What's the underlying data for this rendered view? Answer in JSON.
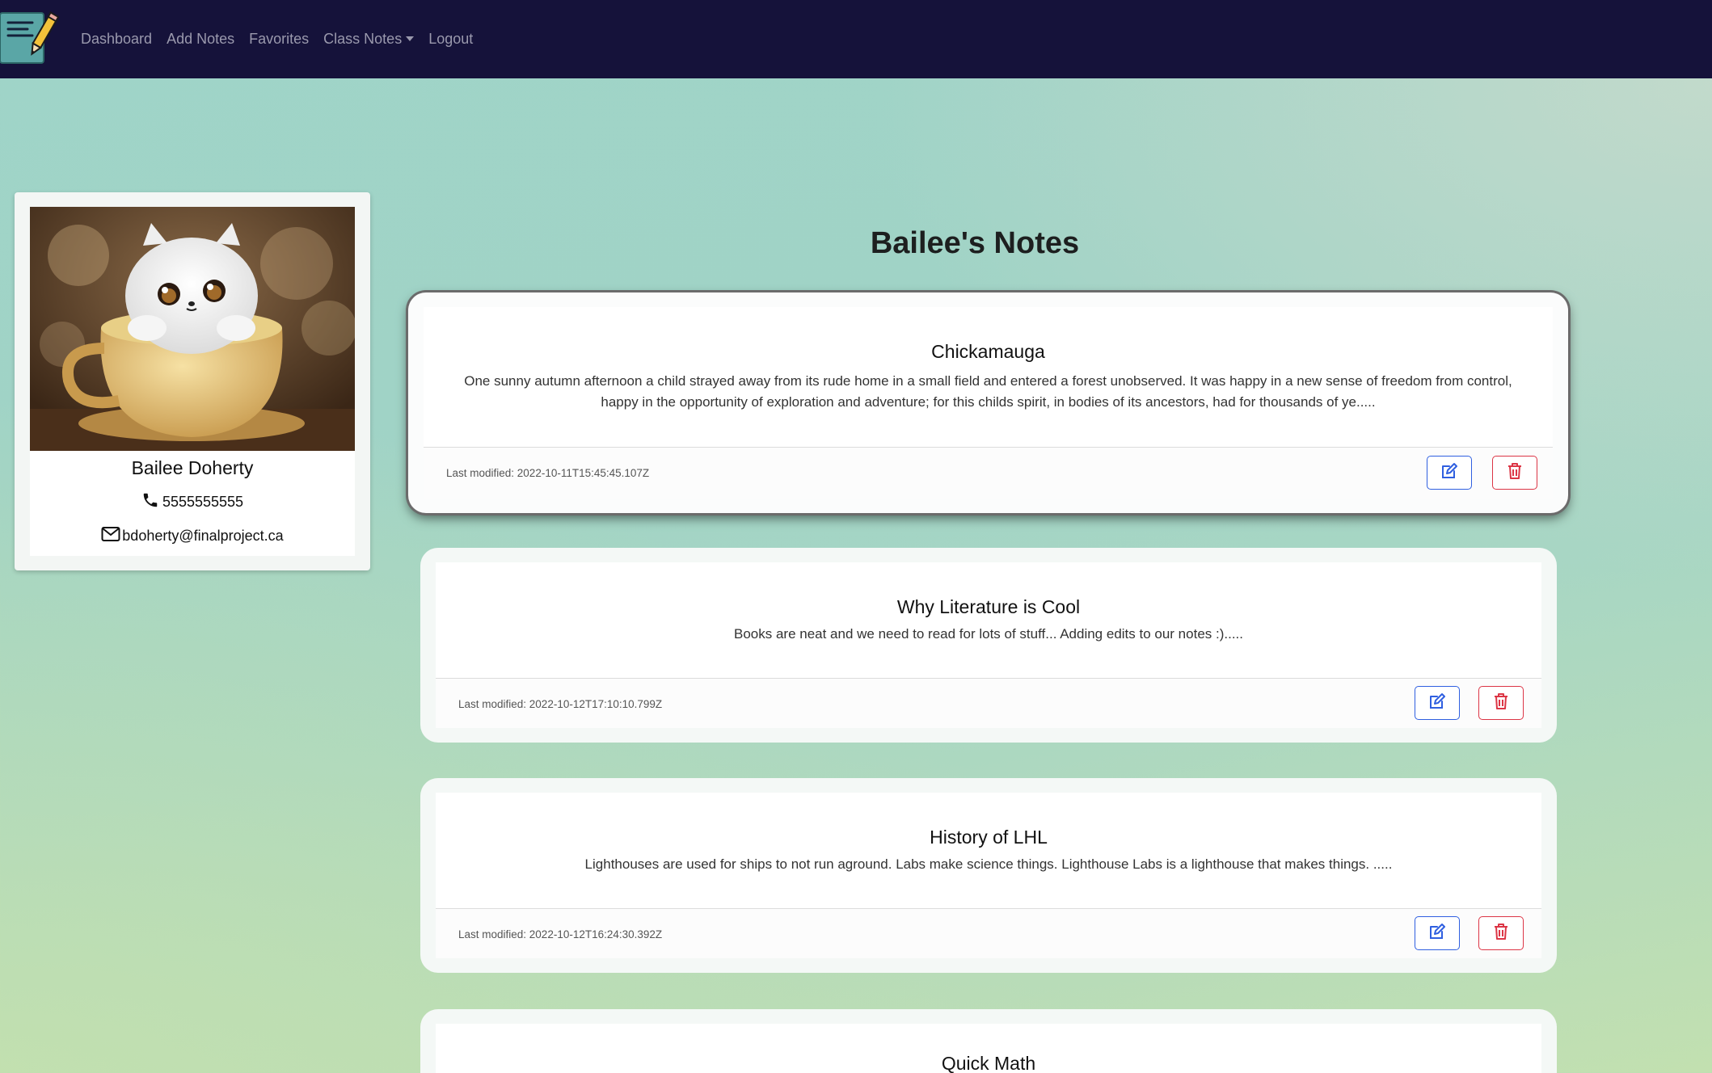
{
  "navbar": {
    "links": [
      "Dashboard",
      "Add Notes",
      "Favorites",
      "Class Notes",
      "Logout"
    ]
  },
  "profile": {
    "name": "Bailee Doherty",
    "phone": "5555555555",
    "email": "bdoherty@finalproject.ca"
  },
  "page": {
    "title": "Bailee's Notes"
  },
  "notes": [
    {
      "title": "Chickamauga",
      "body": "One sunny autumn afternoon a child strayed away from its rude home in a small field and entered a forest unobserved. It was happy in a new sense of freedom from control, happy in the opportunity of exploration and adventure; for this childs spirit, in bodies of its ancestors, had for thousands of ye.....",
      "modified": "Last modified: 2022-10-11T15:45:45.107Z"
    },
    {
      "title": "Why Literature is Cool",
      "body": "Books are neat and we need to read for lots of stuff... Adding edits to our notes :).....",
      "modified": "Last modified: 2022-10-12T17:10:10.799Z"
    },
    {
      "title": "History of LHL",
      "body": "Lighthouses are used for ships to not run aground. Labs make science things. Lighthouse Labs is a lighthouse that makes things. .....",
      "modified": "Last modified: 2022-10-12T16:24:30.392Z"
    },
    {
      "title": "Quick Math"
    }
  ],
  "colors": {
    "navbar": "#15123a",
    "edit": "#2f5fe0",
    "delete": "#dc3545"
  },
  "icons": {
    "logo": "notepad-pencil-icon",
    "phone": "phone-icon",
    "email": "envelope-icon",
    "edit": "pencil-square-icon",
    "delete": "trash-icon"
  }
}
